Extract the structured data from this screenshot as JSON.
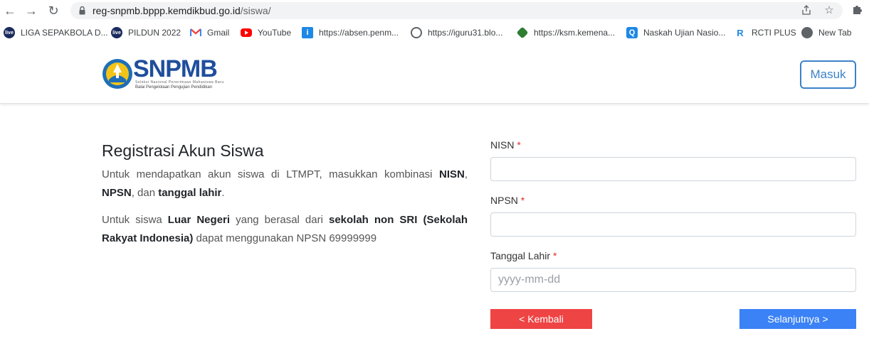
{
  "browser": {
    "url_host": "reg-snpmb.bppp.kemdikbud.go.id",
    "url_path": "/siswa/",
    "bookmarks": [
      {
        "label": "LIGA SEPAKBOLA D...",
        "icon": "live-icon",
        "color": "#1a2a5c"
      },
      {
        "label": "PILDUN 2022",
        "icon": "live-icon",
        "color": "#1a2a5c"
      },
      {
        "label": "Gmail",
        "icon": "gmail-icon",
        "color": "#ea4335"
      },
      {
        "label": "YouTube",
        "icon": "youtube-icon",
        "color": "#ff0000"
      },
      {
        "label": "https://absen.penm...",
        "icon": "info-icon",
        "color": "#1e88e5"
      },
      {
        "label": "https://iguru31.blo...",
        "icon": "globe-icon",
        "color": "#5f6368"
      },
      {
        "label": "https://ksm.kemena...",
        "icon": "kemenag-icon",
        "color": "#2e7d32"
      },
      {
        "label": "Naskah Ujian Nasio...",
        "icon": "q-icon",
        "color": "#1e88e5"
      },
      {
        "label": "RCTI PLUS",
        "icon": "rcti-icon",
        "color": "#1e88e5"
      },
      {
        "label": "New Tab",
        "icon": "globe-icon",
        "color": "#5f6368"
      }
    ]
  },
  "header": {
    "logo_text": "SNPMB",
    "logo_sub1": "Seleksi Nasional Penerimaan Mahasiswa Baru",
    "logo_sub2": "Balai Pengelolaan Pengujian Pendidikan",
    "login_label": "Masuk",
    "brand_color": "#1f4e9c",
    "accent_color": "#3b82c9"
  },
  "intro": {
    "title": "Registrasi Akun Siswa",
    "p1_a": "Untuk mendapatkan akun siswa di LTMPT, masukkan kombinasi ",
    "p1_b": "NISN",
    "p1_c": ", ",
    "p1_d": "NPSN",
    "p1_e": ", dan ",
    "p1_f": "tanggal lahir",
    "p1_g": ".",
    "p2_a": "Untuk siswa ",
    "p2_b": "Luar Negeri",
    "p2_c": " yang berasal dari ",
    "p2_d": "sekolah non SRI (Sekolah Rakyat Indonesia)",
    "p2_e": " dapat menggunakan NPSN 69999999"
  },
  "form": {
    "nisn_label": "NISN",
    "npsn_label": "NPSN",
    "dob_label": "Tanggal Lahir",
    "required_mark": "*",
    "nisn_value": "",
    "npsn_value": "",
    "dob_value": "",
    "dob_placeholder": "yyyy-mm-dd",
    "back_label": "< Kembali",
    "next_label": "Selanjutnya >",
    "back_color": "#ef4444",
    "next_color": "#3b82f6"
  }
}
